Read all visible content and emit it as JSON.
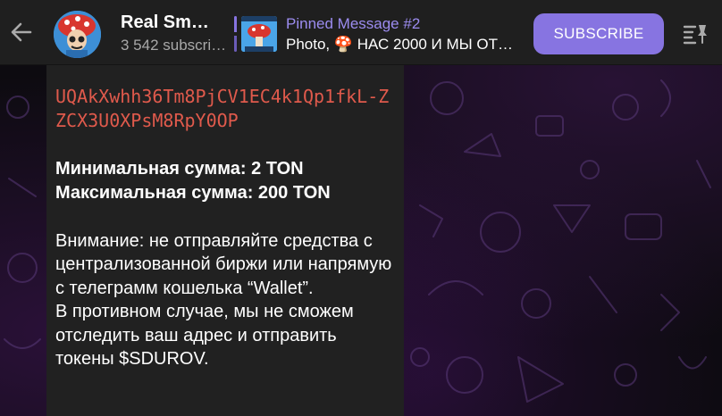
{
  "header": {
    "channel_title": "Real Sm…",
    "subscribers": "3 542 subscri…",
    "pinned_title": "Pinned Message #2",
    "pinned_text": "Photo, 🍄 НАС 2000 И МЫ ОТ…",
    "subscribe_label": "SUBSCRIBE"
  },
  "message": {
    "address": "UQAkXwhh36Tm8PjCV1EC4k1Qp1fkL-ZZCX3U0XPsM8RpY0OP",
    "min_line": "Минимальная сумма: 2 TON",
    "max_line": "Максимальная сумма: 200 TON",
    "warning_1": "Внимание: не отправляйте средства с централизованной биржи или напрямую с телеграмм кошелька “Wallet”.",
    "warning_2": "В противном случае, мы не сможем отследить ваш адрес и отправить токены $SDUROV."
  },
  "colors": {
    "accent": "#8774e1",
    "address": "#e05a4c",
    "topbar": "#1f1f1f",
    "bubble": "#212121"
  },
  "icons": {
    "back": "arrow-left-icon",
    "pin_list": "pinned-list-icon"
  }
}
